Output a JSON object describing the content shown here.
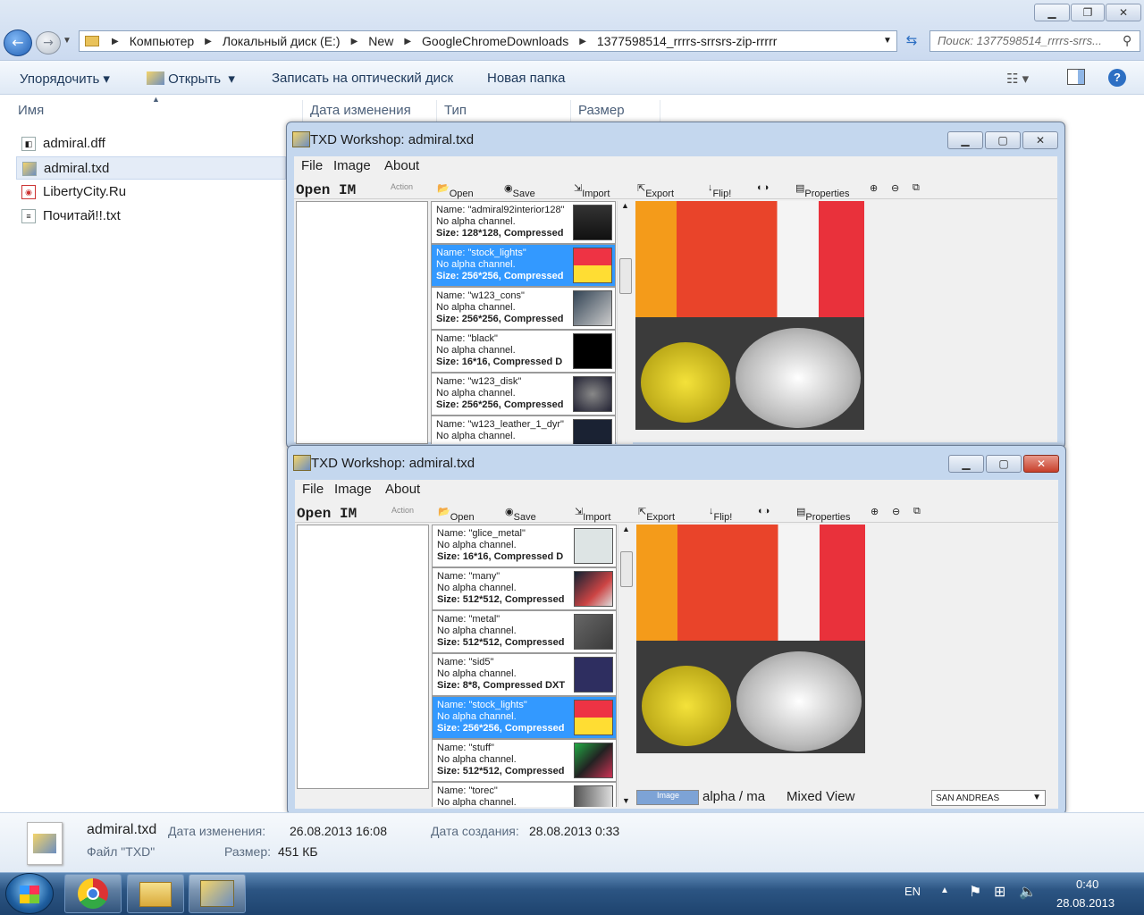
{
  "explorer": {
    "address": [
      "Компьютер",
      "Локальный диск (E:)",
      "New",
      "GoogleChromeDownloads",
      "1377598514_rrrrs-srrsrs-zip-rrrrr"
    ],
    "search_placeholder": "Поиск: 1377598514_rrrrs-srrs...",
    "commands": {
      "organize": "Упорядочить",
      "open": "Открыть",
      "burn": "Записать на оптический диск",
      "new_folder": "Новая папка"
    },
    "columns": {
      "name": "Имя",
      "date": "Дата изменения",
      "type": "Тип",
      "size": "Размер"
    },
    "files": [
      {
        "name": "admiral.dff",
        "selected": false
      },
      {
        "name": "admiral.txd",
        "selected": true
      },
      {
        "name": "LibertyCity.Ru",
        "selected": false
      },
      {
        "name": "Почитай!!.txt",
        "selected": false
      }
    ],
    "details": {
      "filename": "admiral.txd",
      "filetype": "Файл \"TXD\"",
      "modified_label": "Дата изменения:",
      "modified": "26.08.2013 16:08",
      "size_label": "Размер:",
      "size": "451 КБ",
      "created_label": "Дата создания:",
      "created": "28.08.2013 0:33"
    }
  },
  "txd_window_1": {
    "title": "TXD Workshop: admiral.txd",
    "menu": [
      "File",
      "Image",
      "About"
    ],
    "open_im": "Open IM",
    "action": "Action",
    "toolbar": [
      "Open TXD",
      "Save TXD",
      "Import",
      "Export",
      "Flip!",
      "Properties"
    ],
    "textures": [
      {
        "name": "Name: \"admiral92interior128\"",
        "alpha": "No alpha channel.",
        "size": "Size: 128*128, Compressed",
        "selected": false
      },
      {
        "name": "Name: \"stock_lights\"",
        "alpha": "No alpha channel.",
        "size": "Size: 256*256, Compressed",
        "selected": true
      },
      {
        "name": "Name: \"w123_cons\"",
        "alpha": "No alpha channel.",
        "size": "Size: 256*256, Compressed",
        "selected": false
      },
      {
        "name": "Name: \"black\"",
        "alpha": "No alpha channel.",
        "size": "Size: 16*16, Compressed D",
        "selected": false
      },
      {
        "name": "Name: \"w123_disk\"",
        "alpha": "No alpha channel.",
        "size": "Size: 256*256, Compressed",
        "selected": false
      },
      {
        "name": "Name: \"w123_leather_1_dyr\"",
        "alpha": "No alpha channel.",
        "size": "",
        "selected": false
      }
    ]
  },
  "txd_window_2": {
    "title": "TXD Workshop: admiral.txd",
    "menu": [
      "File",
      "Image",
      "About"
    ],
    "open_im": "Open IM",
    "action": "Action",
    "toolbar": [
      "Open TXD",
      "Save TXD",
      "Import",
      "Export",
      "Flip!",
      "Properties"
    ],
    "textures": [
      {
        "name": "Name: \"glice_metal\"",
        "alpha": "No alpha channel.",
        "size": "Size: 16*16, Compressed D",
        "selected": false
      },
      {
        "name": "Name: \"many\"",
        "alpha": "No alpha channel.",
        "size": "Size: 512*512, Compressed",
        "selected": false
      },
      {
        "name": "Name: \"metal\"",
        "alpha": "No alpha channel.",
        "size": "Size: 512*512, Compressed",
        "selected": false
      },
      {
        "name": "Name: \"sid5\"",
        "alpha": "No alpha channel.",
        "size": "Size: 8*8, Compressed DXT",
        "selected": false
      },
      {
        "name": "Name: \"stock_lights\"",
        "alpha": "No alpha channel.",
        "size": "Size: 256*256, Compressed",
        "selected": true
      },
      {
        "name": "Name: \"stuff\"",
        "alpha": "No alpha channel.",
        "size": "Size: 512*512, Compressed",
        "selected": false
      },
      {
        "name": "Name: \"torec\"",
        "alpha": "No alpha channel.",
        "size": "",
        "selected": false
      }
    ],
    "bottom_tabs": {
      "image": "Image",
      "alpha": "alpha / ma",
      "mixed": "Mixed View"
    },
    "game_select": "SAN ANDREAS"
  },
  "taskbar": {
    "lang": "EN",
    "time": "0:40",
    "date": "28.08.2013"
  }
}
